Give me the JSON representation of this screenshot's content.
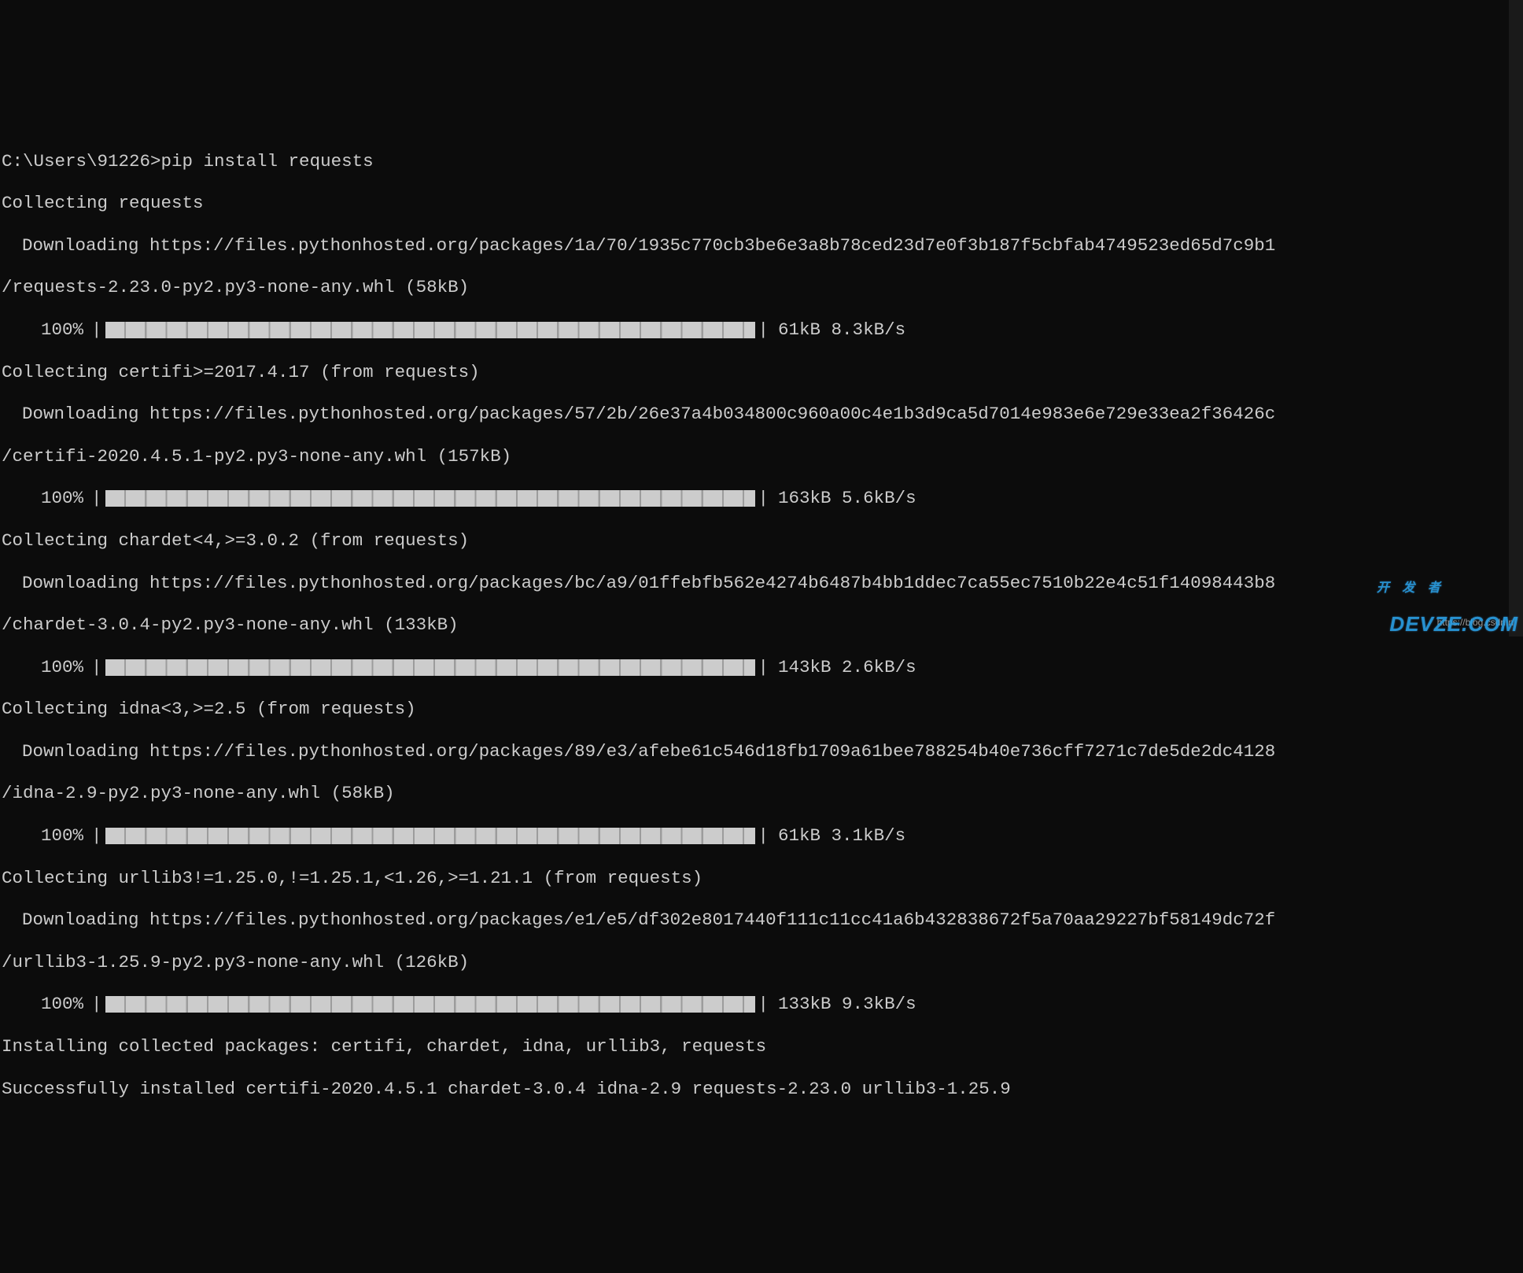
{
  "prompt": "C:\\Users\\91226>pip install requests",
  "lines": {
    "collect_requests": "Collecting requests",
    "dl_requests_1": "Downloading https://files.pythonhosted.org/packages/1a/70/1935c770cb3be6e3a8b78ced23d7e0f3b187f5cbfab4749523ed65d7c9b1",
    "dl_requests_2": "/requests-2.23.0-py2.py3-none-any.whl (58kB)",
    "collect_certifi": "Collecting certifi>=2017.4.17 (from requests)",
    "dl_certifi_1": "Downloading https://files.pythonhosted.org/packages/57/2b/26e37a4b034800c960a00c4e1b3d9ca5d7014e983e6e729e33ea2f36426c",
    "dl_certifi_2": "/certifi-2020.4.5.1-py2.py3-none-any.whl (157kB)",
    "collect_chardet": "Collecting chardet<4,>=3.0.2 (from requests)",
    "dl_chardet_1": "Downloading https://files.pythonhosted.org/packages/bc/a9/01ffebfb562e4274b6487b4bb1ddec7ca55ec7510b22e4c51f14098443b8",
    "dl_chardet_2": "/chardet-3.0.4-py2.py3-none-any.whl (133kB)",
    "collect_idna": "Collecting idna<3,>=2.5 (from requests)",
    "dl_idna_1": "Downloading https://files.pythonhosted.org/packages/89/e3/afebe61c546d18fb1709a61bee788254b40e736cff7271c7de5de2dc4128",
    "dl_idna_2": "/idna-2.9-py2.py3-none-any.whl (58kB)",
    "collect_urllib3": "Collecting urllib3!=1.25.0,!=1.25.1,<1.26,>=1.21.1 (from requests)",
    "dl_urllib3_1": "Downloading https://files.pythonhosted.org/packages/e1/e5/df302e8017440f111c11cc41a6b432838672f5a70aa29227bf58149dc72f",
    "dl_urllib3_2": "/urllib3-1.25.9-py2.py3-none-any.whl (126kB)",
    "installing": "Installing collected packages: certifi, chardet, idna, urllib3, requests",
    "success": "Successfully installed certifi-2020.4.5.1 chardet-3.0.4 idna-2.9 requests-2.23.0 urllib3-1.25.9"
  },
  "progress": {
    "requests": {
      "pct": "100%",
      "stats": "61kB 8.3kB/s"
    },
    "certifi": {
      "pct": "100%",
      "stats": "163kB 5.6kB/s"
    },
    "chardet": {
      "pct": "100%",
      "stats": "143kB 2.6kB/s"
    },
    "idna": {
      "pct": "100%",
      "stats": "61kB 3.1kB/s"
    },
    "urllib3": {
      "pct": "100%",
      "stats": "133kB 9.3kB/s"
    }
  },
  "watermark_url": "https://blog.csdn.n",
  "watermark_logo_top": "开 发 者",
  "watermark_logo_bottom": "DEVZE.COM"
}
